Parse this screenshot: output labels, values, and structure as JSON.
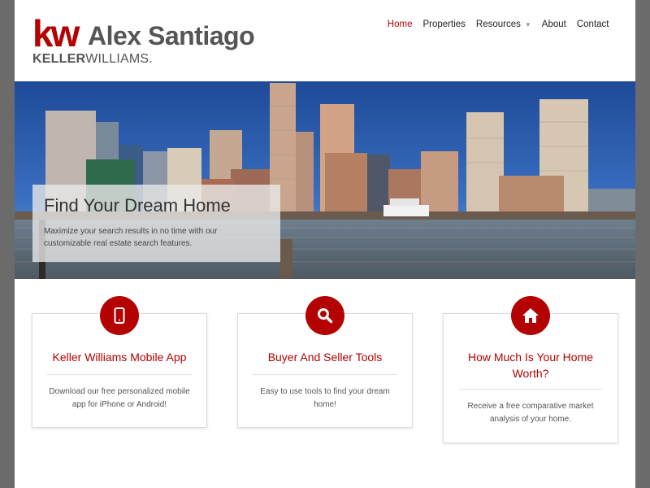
{
  "logo": {
    "mark": "kw",
    "name": "Alex Santiago",
    "brand_bold": "KELLER",
    "brand_light": "WILLIAMS."
  },
  "nav": {
    "items": [
      {
        "label": "Home",
        "active": true
      },
      {
        "label": "Properties",
        "active": false
      },
      {
        "label": "Resources",
        "active": false,
        "dropdown": true
      },
      {
        "label": "About",
        "active": false
      },
      {
        "label": "Contact",
        "active": false
      }
    ]
  },
  "hero": {
    "title": "Find Your Dream Home",
    "text": "Maximize your search results in no time with our customizable real estate search features."
  },
  "cards": [
    {
      "icon": "mobile-icon",
      "title": "Keller Williams Mobile App",
      "text": "Download our free personalized mobile app for iPhone or Android!"
    },
    {
      "icon": "search-icon",
      "title": "Buyer And Seller Tools",
      "text": "Easy to use tools to find your dream home!"
    },
    {
      "icon": "home-icon",
      "title": "How Much Is Your Home Worth?",
      "text": "Receive a free comparative market analysis of your home."
    }
  ],
  "colors": {
    "accent": "#b40101",
    "text": "#333333",
    "background": "#6b6b6b"
  }
}
